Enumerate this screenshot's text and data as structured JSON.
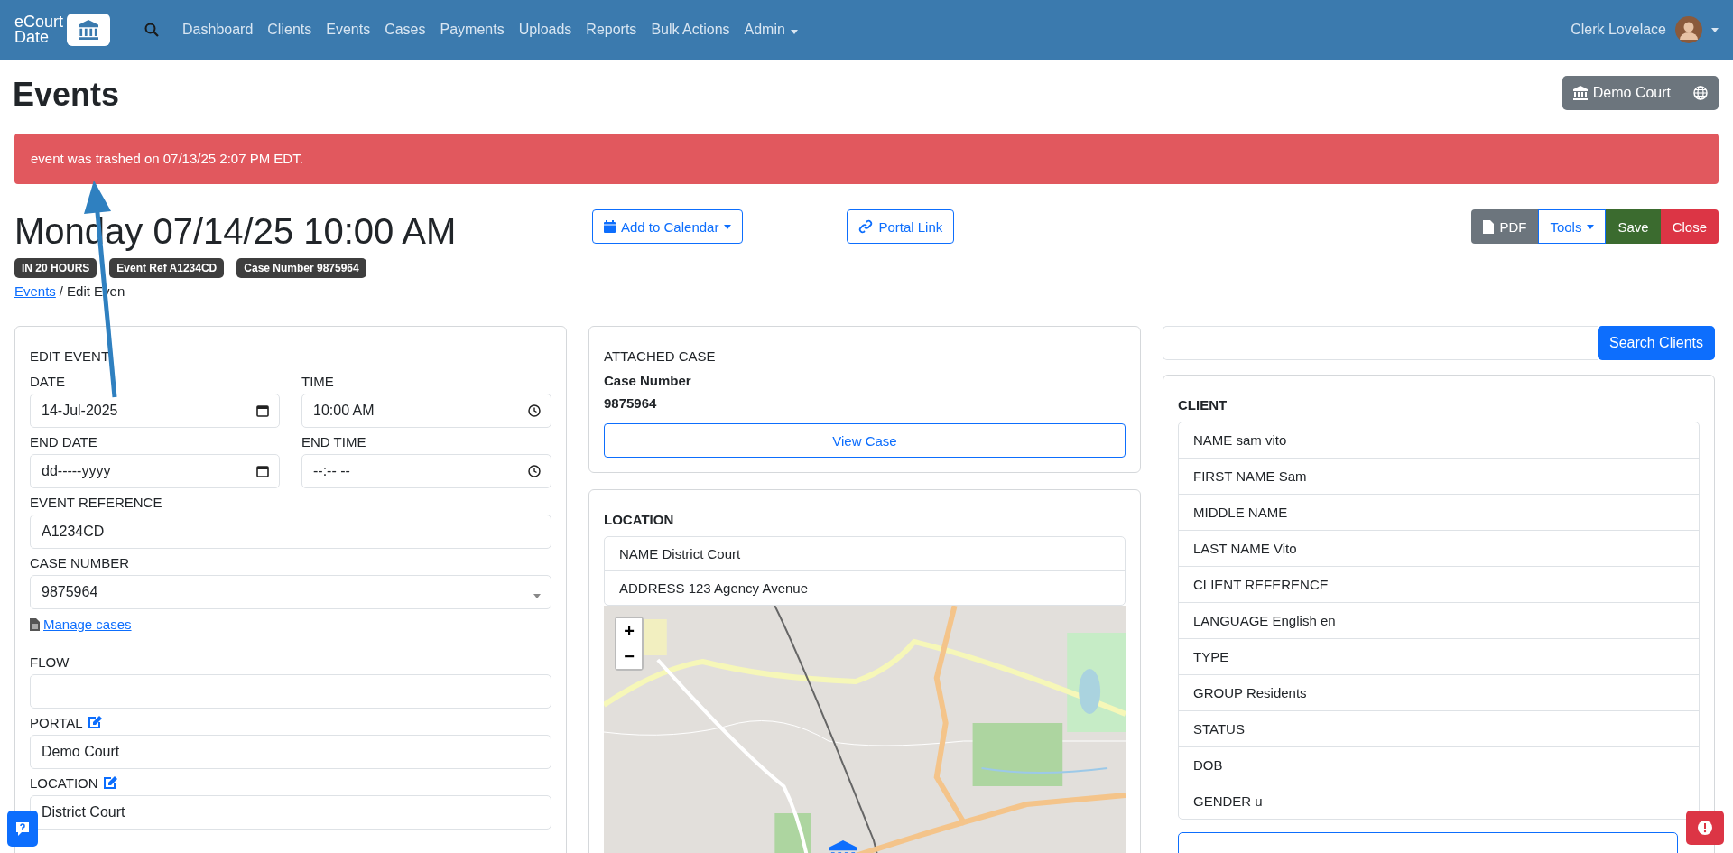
{
  "navbar": {
    "logo_lines": [
      "eCourt",
      "Date"
    ],
    "links": [
      {
        "label": "Dashboard",
        "dropdown": false
      },
      {
        "label": "Clients",
        "dropdown": false
      },
      {
        "label": "Events",
        "dropdown": false
      },
      {
        "label": "Cases",
        "dropdown": false
      },
      {
        "label": "Payments",
        "dropdown": false
      },
      {
        "label": "Uploads",
        "dropdown": false
      },
      {
        "label": "Reports",
        "dropdown": false
      },
      {
        "label": "Bulk Actions",
        "dropdown": false
      },
      {
        "label": "Admin",
        "dropdown": true
      }
    ],
    "user": "Clerk Lovelace"
  },
  "page_title": "Events",
  "court_button": "Demo Court",
  "alert": "event was trashed on 07/13/25 2:07 PM EDT.",
  "event_heading": "Monday 07/14/25 10:00 AM",
  "actions": [
    {
      "label": "Add to Calendar",
      "kind": "calendar"
    },
    {
      "label": "Portal Link",
      "kind": "link"
    }
  ],
  "toolbar": [
    {
      "label": "PDF",
      "kind": "pdf"
    },
    {
      "label": "Tools",
      "kind": "tools"
    },
    {
      "label": "Save",
      "kind": "save"
    },
    {
      "label": "Close",
      "kind": "close"
    }
  ],
  "badges": [
    "IN 20 HOURS",
    "Event Ref A1234CD",
    "Case Number 9875964"
  ],
  "breadcrumb": {
    "link": "Events",
    "separator": "/",
    "current": "Edit Even"
  },
  "edit_event": {
    "title": "EDIT EVENT",
    "rows": [
      {
        "kind": "fields",
        "fields": [
          {
            "label": "DATE",
            "value": "14-Jul-2025",
            "kind": "date",
            "editable": false
          },
          {
            "label": "TIME",
            "value": "10:00 AM",
            "kind": "time",
            "editable": false
          }
        ]
      },
      {
        "kind": "fields",
        "fields": [
          {
            "label": "END DATE",
            "placeholder": "dd-----yyyy",
            "kind": "date",
            "editable": false
          },
          {
            "label": "END TIME",
            "placeholder": "--:-- --",
            "kind": "time",
            "editable": false
          }
        ]
      },
      {
        "kind": "fields",
        "fields": [
          {
            "label": "EVENT REFERENCE",
            "value": "A1234CD",
            "kind": "text",
            "editable": false
          }
        ]
      },
      {
        "kind": "fields",
        "fields": [
          {
            "label": "CASE NUMBER",
            "value": "9875964",
            "kind": "select",
            "editable": false
          }
        ]
      },
      {
        "kind": "link",
        "label": "Manage cases"
      },
      {
        "kind": "fields",
        "fields": [
          {
            "label": "FLOW",
            "kind": "text",
            "editable": false
          }
        ]
      },
      {
        "kind": "fields",
        "fields": [
          {
            "label": "PORTAL",
            "value": "Demo Court",
            "kind": "text",
            "editable": true
          }
        ]
      },
      {
        "kind": "fields",
        "fields": [
          {
            "label": "LOCATION",
            "value": "District Court",
            "kind": "text",
            "editable": true
          }
        ]
      }
    ]
  },
  "attached_case": {
    "title": "ATTACHED CASE",
    "label": "Case Number",
    "number": "9875964",
    "button": "View Case"
  },
  "location": {
    "title": "LOCATION",
    "items": [
      "NAME District Court",
      "ADDRESS 123 Agency Avenue"
    ],
    "map": {
      "kind": "picture",
      "zoom_in": "+",
      "zoom_out": "−"
    }
  },
  "client_search": {
    "button": "Search Clients"
  },
  "client": {
    "title": "CLIENT",
    "items": [
      "NAME sam vito",
      "FIRST NAME Sam",
      "MIDDLE NAME",
      "LAST NAME Vito",
      "CLIENT REFERENCE",
      "LANGUAGE English en",
      "TYPE",
      "GROUP Residents",
      "STATUS",
      "DOB",
      "GENDER u"
    ]
  }
}
